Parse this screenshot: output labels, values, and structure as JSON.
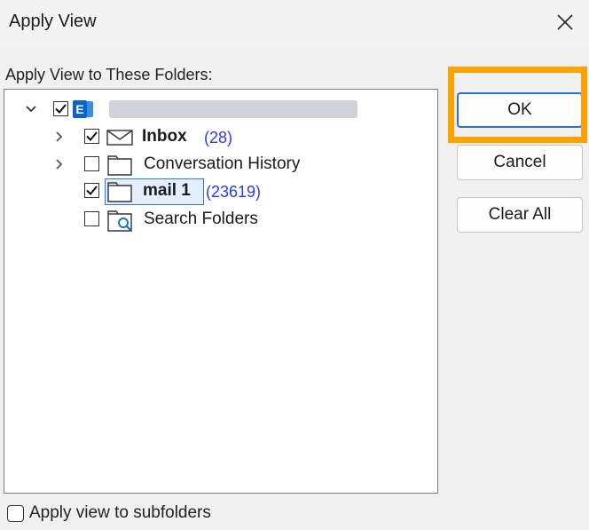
{
  "dialog": {
    "title": "Apply View",
    "close_icon": "close-icon"
  },
  "folders_label": "Apply View to These Folders:",
  "tree": {
    "root": {
      "expanded": true,
      "checked": true,
      "icon": "exchange-account-icon",
      "name_redacted": true
    },
    "items": [
      {
        "label": "Inbox",
        "count": "(28)",
        "checked": true,
        "expandable": true,
        "bold": true,
        "icon": "mail-icon"
      },
      {
        "label": "Conversation History",
        "count": "",
        "checked": false,
        "expandable": true,
        "bold": false,
        "icon": "folder-icon"
      },
      {
        "label": "mail 1",
        "count": "(23619)",
        "checked": true,
        "expandable": false,
        "bold": true,
        "selected": true,
        "icon": "folder-icon"
      },
      {
        "label": "Search Folders",
        "count": "",
        "checked": false,
        "expandable": false,
        "bold": false,
        "icon": "search-folder-icon"
      }
    ]
  },
  "buttons": {
    "ok": "OK",
    "cancel": "Cancel",
    "clear_all": "Clear All"
  },
  "subfolders": {
    "label": "Apply view to subfolders",
    "checked": false
  },
  "colors": {
    "highlight": "#ffa200",
    "count": "#2f3ae8",
    "default_button_border": "#2f6fd0",
    "exchange_blue": "#0a64c8"
  }
}
